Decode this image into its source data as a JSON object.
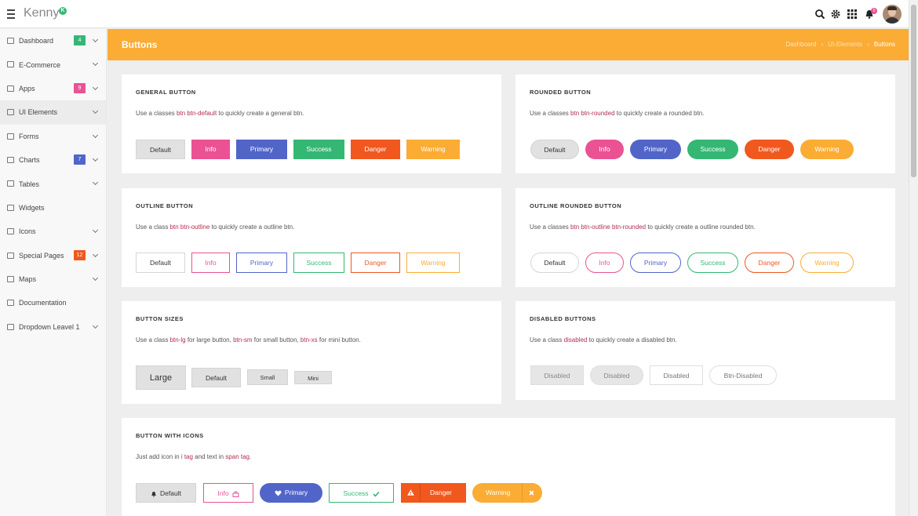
{
  "app": {
    "name": "Kenny",
    "logo_mark": "K",
    "notif_count": "5"
  },
  "colors": {
    "accent": "#fbac34",
    "info": "#ea5294",
    "primary": "#5165c9",
    "success": "#35b774",
    "danger": "#f0581e",
    "warning": "#fbac34"
  },
  "topbar_icons": [
    "menu-icon",
    "search-icon",
    "gear-icon",
    "grid-icon",
    "bell-icon",
    "avatar"
  ],
  "sidebar": {
    "items": [
      {
        "label": "Dashboard",
        "icon": "dashboard-icon",
        "badge": "4",
        "badge_color": "#35b774",
        "chevron": true
      },
      {
        "label": "E-Commerce",
        "icon": "cart-icon",
        "badge": "",
        "chevron": true
      },
      {
        "label": "Apps",
        "icon": "apps-icon",
        "badge": "9",
        "badge_color": "#ea5294",
        "chevron": true
      },
      {
        "label": "UI Elements",
        "icon": "ui-elements-icon",
        "badge": "",
        "chevron": true
      },
      {
        "label": "Forms",
        "icon": "forms-icon",
        "badge": "",
        "chevron": true
      },
      {
        "label": "Charts",
        "icon": "chart-icon",
        "badge": "7",
        "badge_color": "#5165c9",
        "chevron": true
      },
      {
        "label": "Tables",
        "icon": "list-icon",
        "badge": "",
        "chevron": true
      },
      {
        "label": "Widgets",
        "icon": "widgets-icon",
        "badge": "",
        "chevron": false
      },
      {
        "label": "Icons",
        "icon": "dots-icon",
        "badge": "",
        "chevron": true
      },
      {
        "label": "Special Pages",
        "icon": "layers-icon",
        "badge": "12",
        "badge_color": "#f0581e",
        "chevron": true
      },
      {
        "label": "Maps",
        "icon": "map-icon",
        "badge": "",
        "chevron": true
      },
      {
        "label": "Documentation",
        "icon": "document-icon",
        "badge": "",
        "chevron": false
      },
      {
        "label": "Dropdown Leavel 1",
        "icon": "dropdown-icon",
        "badge": "",
        "chevron": true
      }
    ]
  },
  "header": {
    "title": "Buttons",
    "breadcrumbs": [
      "Dashboard",
      "UI-Elements",
      "Buttons"
    ]
  },
  "cards": {
    "general": {
      "title": "GENERAL BUTTON",
      "desc_pre": "Use a classes ",
      "desc_code": "btn btn-default",
      "desc_post": " to quickly create a general btn.",
      "buttons": [
        "Default",
        "Info",
        "Primary",
        "Success",
        "Danger",
        "Warning"
      ]
    },
    "rounded": {
      "title": "ROUNDED BUTTON",
      "desc_pre": "Use a classes ",
      "desc_code": "btn btn-rounded",
      "desc_post": " to quickly create a rounded btn.",
      "buttons": [
        "Default",
        "Info",
        "Primary",
        "Success",
        "Danger",
        "Warning"
      ]
    },
    "outline": {
      "title": "OUTLINE BUTTON",
      "desc_pre": "Use a class ",
      "desc_code": "btn btn-outline",
      "desc_post": " to quickly create a outline btn.",
      "buttons": [
        "Default",
        "Info",
        "Primary",
        "Success",
        "Danger",
        "Warning"
      ]
    },
    "outline_rounded": {
      "title": "OUTLINE ROUNDED BUTTON",
      "desc_pre": "Use a classes ",
      "desc_code": "btn btn-outline btn-rounded",
      "desc_post": " to quickly create a outline rounded btn.",
      "buttons": [
        "Default",
        "Info",
        "Primary",
        "Success",
        "Danger",
        "Warning"
      ]
    },
    "sizes": {
      "title": "BUTTON SIZES",
      "desc_a": "Use a class ",
      "code_a": "btn-lg",
      "desc_b": " for large button, ",
      "code_b": "btn-sm",
      "desc_c": " for small button, ",
      "code_c": "btn-xs",
      "desc_d": " for mini button.",
      "buttons": [
        "Large",
        "Default",
        "Small",
        "Mini"
      ]
    },
    "disabled": {
      "title": "DISABLED BUTTONS",
      "desc_pre": "Use a class ",
      "desc_code": "disabled",
      "desc_post": " to quickly create a disabled btn.",
      "buttons": [
        "Disabled",
        "Disabled",
        "Disabled",
        "Btn-Disabled"
      ]
    },
    "icons": {
      "title": "BUTTON WITH ICONS",
      "desc_a": "Just add icon in ",
      "code_a": "i tag",
      "desc_b": " and text in ",
      "code_b": "span tag",
      "desc_c": ".",
      "buttons": [
        {
          "label": "Default",
          "icon": "bell-icon"
        },
        {
          "label": "Info",
          "icon": "shopping-bag-icon"
        },
        {
          "label": "Primary",
          "icon": "heart-icon"
        },
        {
          "label": "Success",
          "icon": "check-icon"
        },
        {
          "label": "Danger",
          "icon": "warning-icon"
        },
        {
          "label": "Warning",
          "icon": "close-icon"
        }
      ]
    }
  }
}
